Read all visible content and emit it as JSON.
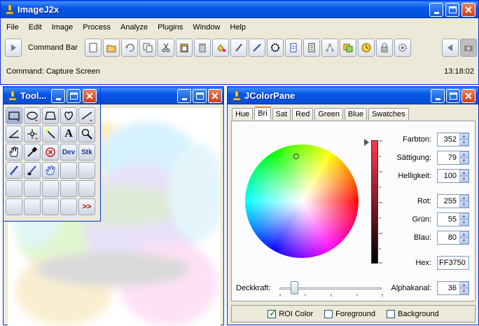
{
  "main_window": {
    "title": "ImageJ2x",
    "menu": [
      "File",
      "Edit",
      "Image",
      "Process",
      "Analyze",
      "Plugins",
      "Window",
      "Help"
    ],
    "command_bar_label": "Command Bar",
    "toolbar_icons": [
      "new-icon",
      "open-icon",
      "undo-icon",
      "copy-icon",
      "cut-icon",
      "paste-icon",
      "delete-icon",
      "fill-icon",
      "draw-icon",
      "line-icon",
      "select-all-icon",
      "document-icon",
      "page-icon",
      "network-icon",
      "duplicate-icon",
      "clock-icon",
      "lock-icon",
      "gear-icon"
    ],
    "status": "Command: Capture Screen",
    "time": "13:18:02"
  },
  "tools_window": {
    "title": "Tool...",
    "text_tools": {
      "text_tool": "A",
      "dev_tool": "Dev",
      "stk_tool": "Stk",
      "more_tool": ">>"
    }
  },
  "color_window": {
    "title": "JColorPane",
    "tabs": [
      "Hue",
      "Bri",
      "Sat",
      "Red",
      "Green",
      "Blue",
      "Swatches"
    ],
    "active_tab": "Bri",
    "fields": {
      "farbton": {
        "label": "Farbton:",
        "value": "352"
      },
      "saettigung": {
        "label": "Sättigung:",
        "value": "79"
      },
      "helligkeit": {
        "label": "Helligkeit:",
        "value": "100"
      },
      "rot": {
        "label": "Rot:",
        "value": "255"
      },
      "gruen": {
        "label": "Grün:",
        "value": "55"
      },
      "blau": {
        "label": "Blau:",
        "value": "80"
      },
      "hex": {
        "label": "Hex:",
        "value": "FF3750"
      },
      "alpha": {
        "label": "Alphakanal:",
        "value": "36"
      }
    },
    "deckkraft_label": "Deckkraft:",
    "checkboxes": [
      {
        "label": "ROI Color",
        "checked": true
      },
      {
        "label": "Foreground",
        "checked": false
      },
      {
        "label": "Background",
        "checked": false
      }
    ],
    "selected_color": "#ff3750"
  }
}
